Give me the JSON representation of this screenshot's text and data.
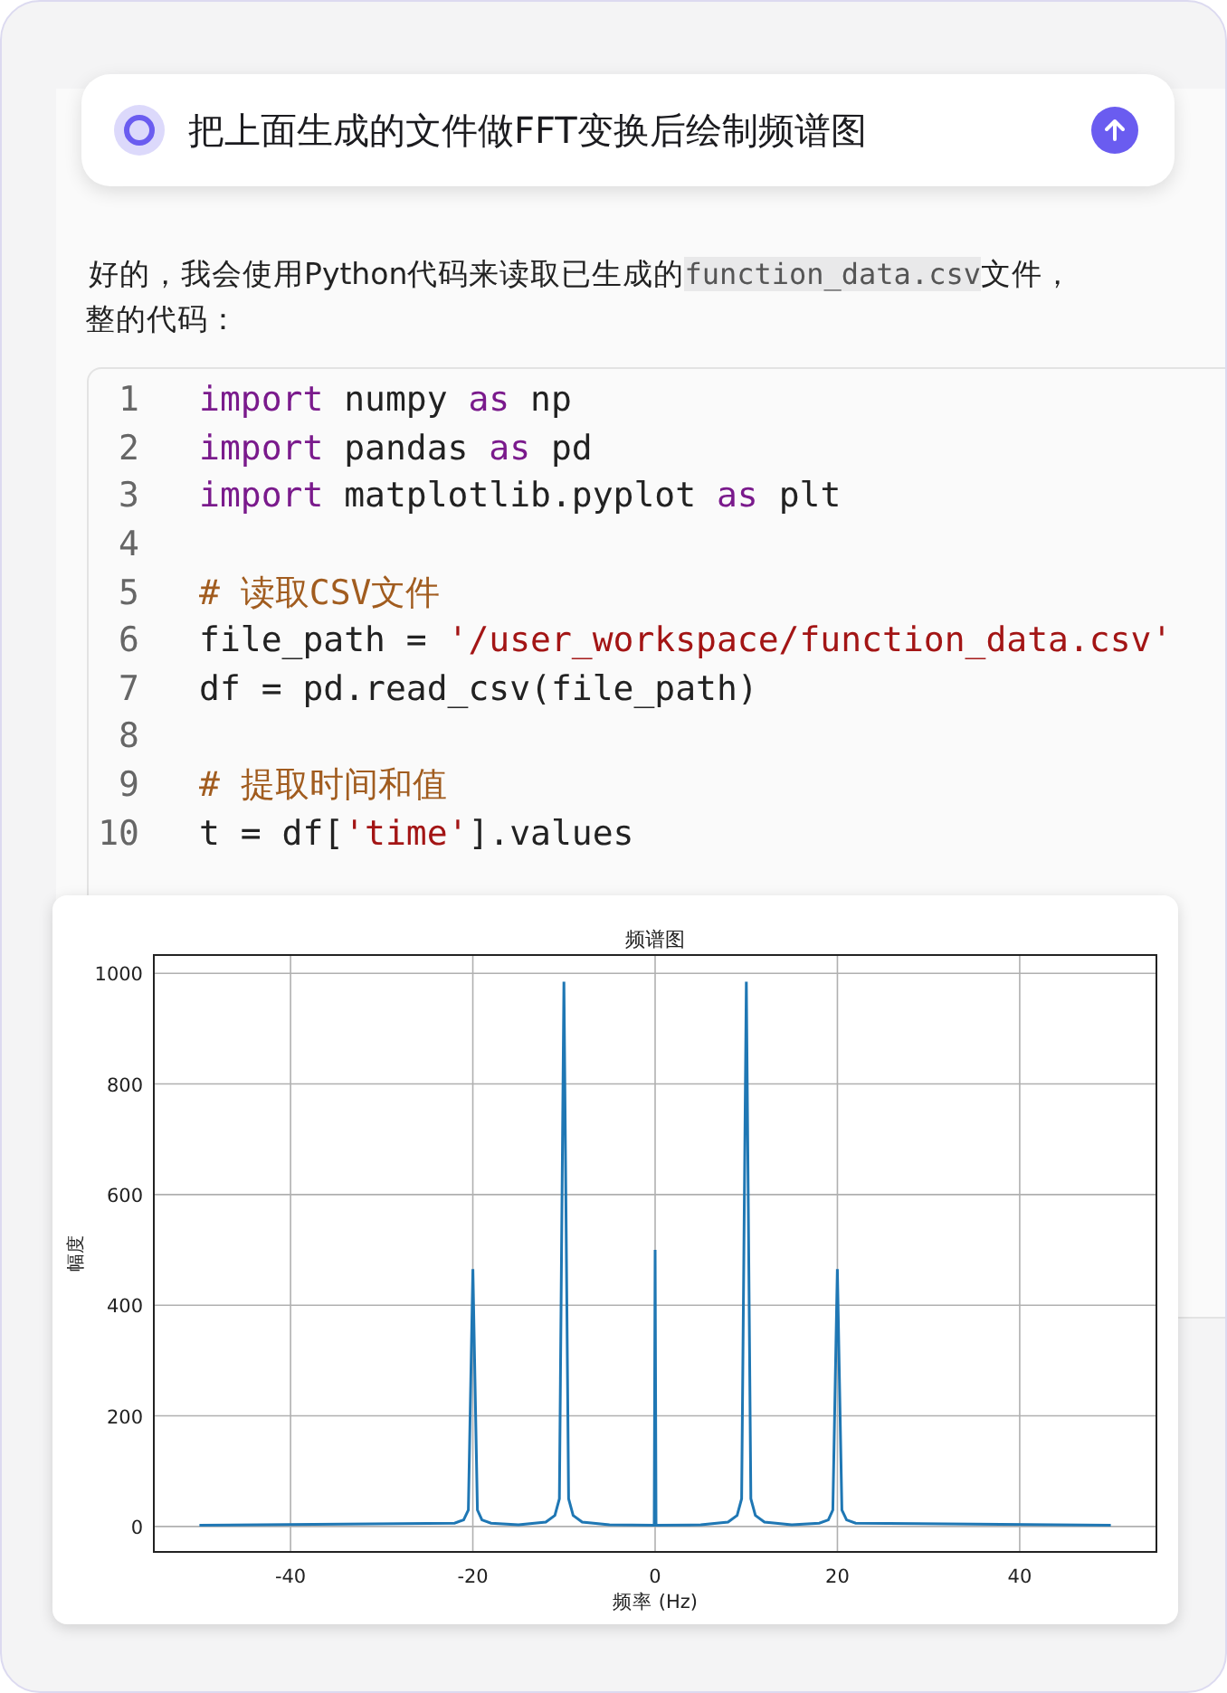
{
  "prompt": {
    "text": "把上面生成的文件做FFT变换后绘制频谱图"
  },
  "reply": {
    "lines": [
      [
        {
          "kind": "text",
          "text": "好的，我会使用Python代码来读取已生成的"
        },
        {
          "kind": "code",
          "text": "function_data.csv"
        },
        {
          "kind": "text",
          "text": "文件，"
        }
      ],
      [
        {
          "kind": "text",
          "text": "整的代码："
        }
      ]
    ]
  },
  "code_block": {
    "lines": [
      {
        "number": "1",
        "tokens": [
          {
            "kind": "keyword",
            "text": "import"
          },
          {
            "kind": "plain",
            "text": " numpy "
          },
          {
            "kind": "keyword",
            "text": "as"
          },
          {
            "kind": "plain",
            "text": " np"
          }
        ]
      },
      {
        "number": "2",
        "tokens": [
          {
            "kind": "keyword",
            "text": "import"
          },
          {
            "kind": "plain",
            "text": " pandas "
          },
          {
            "kind": "keyword",
            "text": "as"
          },
          {
            "kind": "plain",
            "text": " pd"
          }
        ]
      },
      {
        "number": "3",
        "tokens": [
          {
            "kind": "keyword",
            "text": "import"
          },
          {
            "kind": "plain",
            "text": " matplotlib.pyplot "
          },
          {
            "kind": "keyword",
            "text": "as"
          },
          {
            "kind": "plain",
            "text": " plt"
          }
        ]
      },
      {
        "number": "4"
      },
      {
        "number": "5",
        "tokens": [
          {
            "kind": "comment",
            "text": "# 读取CSV文件"
          }
        ]
      },
      {
        "number": "6",
        "tokens": [
          {
            "kind": "plain",
            "text": "file_path = "
          },
          {
            "kind": "string",
            "text": "'/user_workspace/function_data.csv'"
          }
        ]
      },
      {
        "number": "7",
        "tokens": [
          {
            "kind": "plain",
            "text": "df = pd.read_csv(file_path)"
          }
        ]
      },
      {
        "number": "8"
      },
      {
        "number": "9",
        "tokens": [
          {
            "kind": "comment",
            "text": "# 提取时间和值"
          }
        ]
      },
      {
        "number": "10",
        "tokens": [
          {
            "kind": "plain",
            "text": "t = df["
          },
          {
            "kind": "string",
            "text": "'time'"
          },
          {
            "kind": "plain",
            "text": "].values"
          }
        ]
      }
    ]
  },
  "figure": {
    "chart_data": {
      "type": "line",
      "title": "频谱图",
      "xlabel": "频率 (Hz)",
      "ylabel": "幅度",
      "x": [
        -50,
        -22,
        -21,
        -20.5,
        -20,
        -19.5,
        -19,
        -18,
        -15,
        -12,
        -11,
        -10.5,
        -10,
        -9.5,
        -9,
        -8,
        -5,
        -0.1,
        0,
        0.1,
        5,
        8,
        9,
        9.5,
        10,
        10.5,
        11,
        12,
        15,
        18,
        19,
        19.5,
        20,
        20.5,
        21,
        22,
        50
      ],
      "series": [
        {
          "color": "#1f77b4",
          "values": [
            2,
            6,
            12,
            30,
            465,
            30,
            12,
            6,
            3,
            8,
            20,
            50,
            985,
            50,
            20,
            8,
            3,
            2,
            500,
            2,
            3,
            8,
            20,
            50,
            985,
            50,
            20,
            8,
            3,
            6,
            12,
            30,
            465,
            30,
            12,
            6,
            2
          ]
        }
      ],
      "grid": true,
      "xlim": [
        -55,
        55
      ],
      "ylim": [
        -46,
        1033
      ],
      "xticks": [
        -40,
        -20,
        0,
        20,
        40
      ],
      "yticks": [
        0,
        200,
        400,
        600,
        800,
        1000
      ]
    }
  }
}
